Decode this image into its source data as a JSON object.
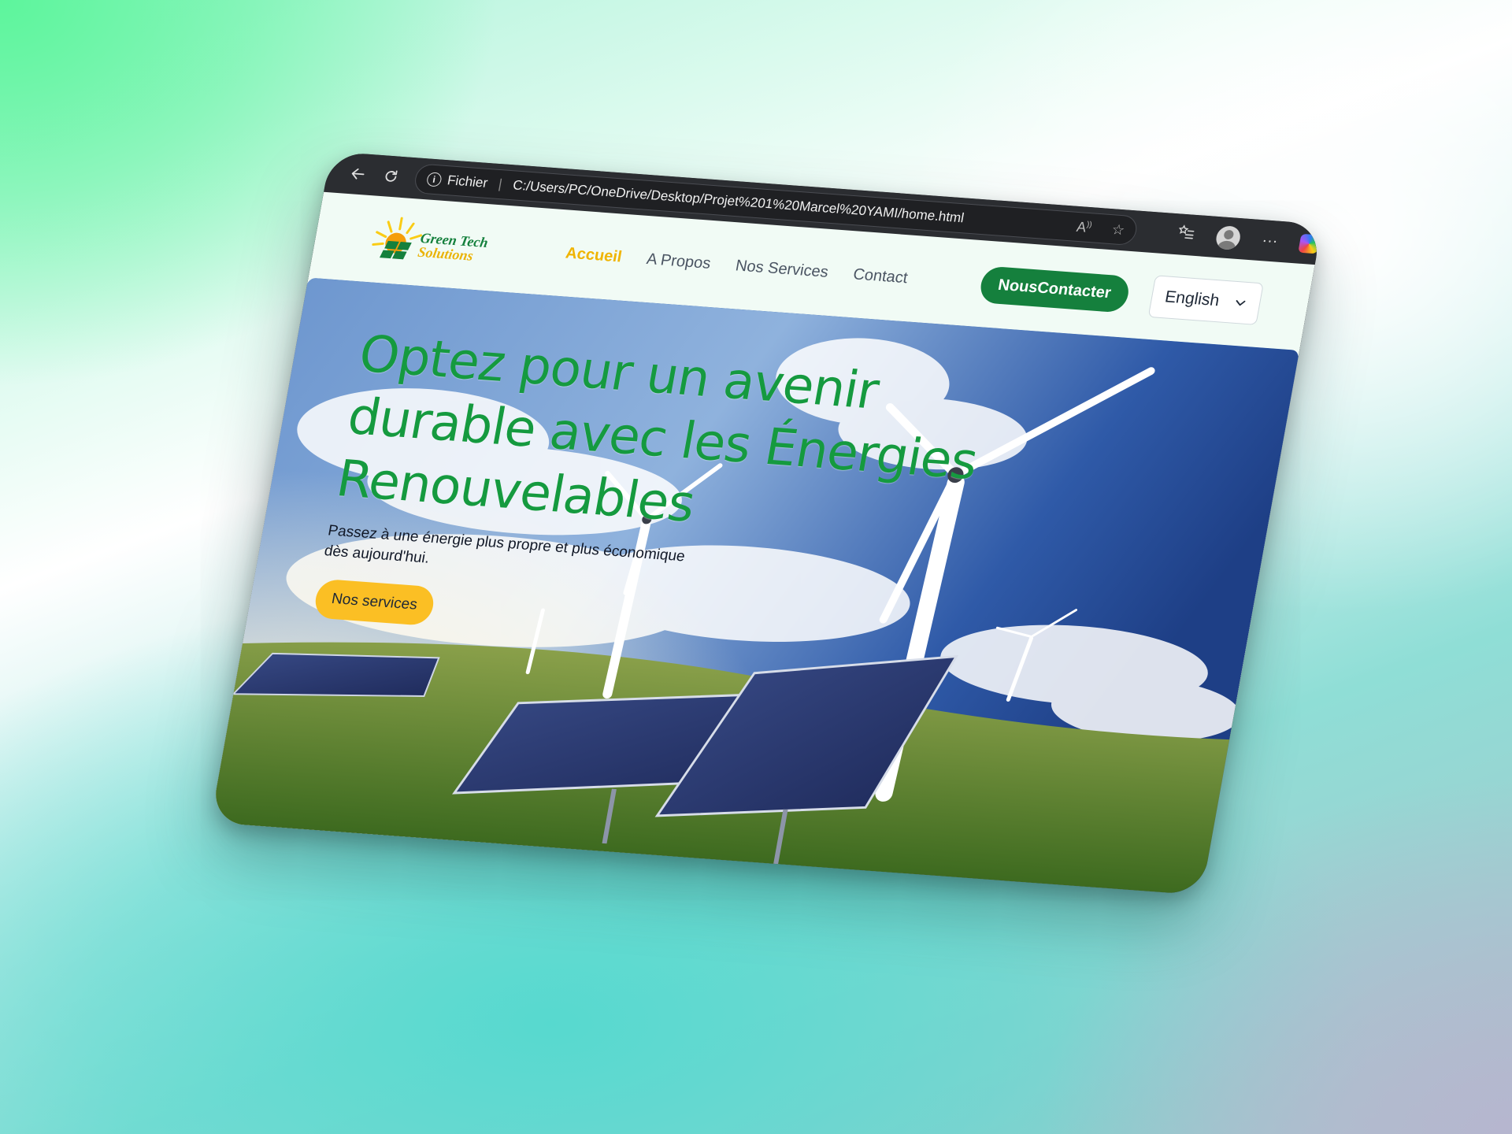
{
  "browser": {
    "back_icon": "arrow-left-icon",
    "reload_icon": "refresh-icon",
    "site_info_label": "Fichier",
    "url": "C:/Users/PC/OneDrive/Desktop/Projet%201%20Marcel%20YAMI/home.html",
    "read_aloud_glyph": "A",
    "favorite_icon": "star-icon",
    "collections_icon": "favorites-list-icon",
    "more_label": "···"
  },
  "site": {
    "logo": {
      "line1": "Green Tech",
      "line2": "Solutions"
    },
    "nav": [
      {
        "label": "Accueil",
        "active": true
      },
      {
        "label": "A Propos",
        "active": false
      },
      {
        "label": "Nos Services",
        "active": false
      },
      {
        "label": "Contact",
        "active": false
      }
    ],
    "cta_label": "NousContacter",
    "language": {
      "selected": "English"
    },
    "colors": {
      "brand_green": "#15803d",
      "accent_yellow": "#fbbf24",
      "hero_title": "#159a3f"
    }
  },
  "hero": {
    "title": "Optez pour un avenir durable avec les Énergies Renouvelables",
    "subtitle": "Passez à une énergie plus propre et plus économique dès aujourd'hui.",
    "button_label": "Nos services"
  }
}
